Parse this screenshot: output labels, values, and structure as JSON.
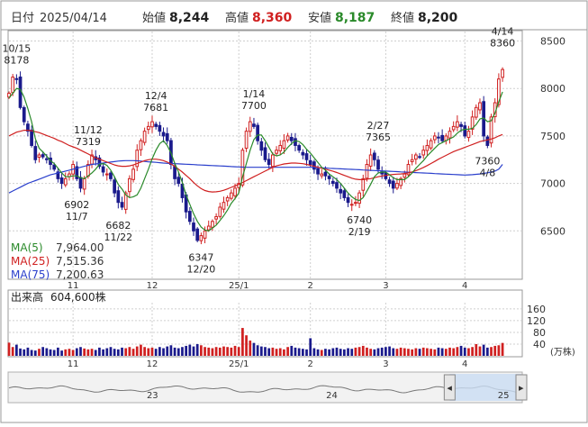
{
  "header": {
    "date_label": "日付",
    "date": "2025/04/14",
    "open_label": "始値",
    "open": "8,244",
    "high_label": "高値",
    "high": "8,360",
    "low_label": "安値",
    "low": "8,187",
    "close_label": "終値",
    "close": "8,200"
  },
  "colors": {
    "up": "#d02020",
    "down": "#1a1a8c",
    "ma5": "#2a8a2a",
    "ma25": "#d02020",
    "ma75": "#2a3fcc",
    "grid": "#cfcfcf",
    "high_value": "#d02020",
    "low_value": "#2a8a2a"
  },
  "legend": [
    {
      "label": "MA(5)",
      "value": "7,964.00",
      "color": "#2a8a2a"
    },
    {
      "label": "MA(25)",
      "value": "7,515.36",
      "color": "#d02020"
    },
    {
      "label": "MA(75)",
      "value": "7,200.63",
      "color": "#2a3fcc"
    }
  ],
  "volume_panel": {
    "label": "出来高",
    "value": "604,600株",
    "unit": "(万株)"
  },
  "chart_data": {
    "type": "candlestick",
    "ylim": [
      6000,
      8600
    ],
    "y_ticks": [
      6500,
      7000,
      7500,
      8000,
      8500
    ],
    "x_range": [
      0,
      136
    ],
    "x_ticks": [
      {
        "label": "11",
        "index": 17
      },
      {
        "label": "12",
        "index": 38
      },
      {
        "label": "25/1",
        "index": 61
      },
      {
        "label": "2",
        "index": 80
      },
      {
        "label": "3",
        "index": 100
      },
      {
        "label": "4",
        "index": 121
      }
    ],
    "annotations": [
      {
        "date": "10/15",
        "value": "8178",
        "index": 2,
        "price": 8178,
        "pos": "above"
      },
      {
        "date": "11/12",
        "value": "7319",
        "index": 21,
        "price": 7319,
        "pos": "above"
      },
      {
        "date": "11/7",
        "value": "6902",
        "index": 18,
        "price": 6902,
        "pos": "below"
      },
      {
        "date": "12/4",
        "value": "7681",
        "index": 39,
        "price": 7681,
        "pos": "above"
      },
      {
        "date": "11/22",
        "value": "6682",
        "index": 29,
        "price": 6682,
        "pos": "below"
      },
      {
        "date": "12/20",
        "value": "6347",
        "index": 51,
        "price": 6347,
        "pos": "below"
      },
      {
        "date": "1/14",
        "value": "7700",
        "index": 65,
        "price": 7700,
        "pos": "above"
      },
      {
        "date": "2/19",
        "value": "6740",
        "index": 93,
        "price": 6740,
        "pos": "below"
      },
      {
        "date": "2/27",
        "value": "7365",
        "index": 98,
        "price": 7365,
        "pos": "above"
      },
      {
        "date": "4/8",
        "value": "7360",
        "index": 127,
        "price": 7360,
        "pos": "below"
      },
      {
        "date": "4/14",
        "value": "8360",
        "index": 131,
        "price": 8360,
        "pos": "above"
      }
    ],
    "close": [
      7950,
      8120,
      8100,
      7800,
      7650,
      7550,
      7400,
      7250,
      7300,
      7280,
      7250,
      7200,
      7150,
      7050,
      7000,
      7050,
      7100,
      7200,
      7050,
      6950,
      7050,
      7200,
      7300,
      7250,
      7180,
      7120,
      7100,
      7050,
      6900,
      6800,
      6750,
      6900,
      7050,
      7150,
      7350,
      7450,
      7550,
      7600,
      7650,
      7600,
      7550,
      7500,
      7450,
      7200,
      7050,
      7000,
      6850,
      6700,
      6600,
      6500,
      6400,
      6450,
      6500,
      6550,
      6600,
      6650,
      6750,
      6800,
      6850,
      6900,
      6950,
      7000,
      7350,
      7550,
      7650,
      7600,
      7450,
      7350,
      7250,
      7200,
      7300,
      7350,
      7400,
      7450,
      7500,
      7450,
      7400,
      7350,
      7300,
      7250,
      7200,
      7150,
      7100,
      7100,
      7080,
      7050,
      7000,
      6950,
      6900,
      6850,
      6800,
      6780,
      6800,
      6900,
      7050,
      7200,
      7300,
      7250,
      7150,
      7100,
      7050,
      7000,
      6950,
      7000,
      7050,
      7100,
      7200,
      7250,
      7300,
      7280,
      7350,
      7400,
      7450,
      7500,
      7480,
      7450,
      7500,
      7550,
      7600,
      7650,
      7600,
      7500,
      7550,
      7700,
      7800,
      7850,
      7500,
      7400,
      7700,
      7850,
      8100,
      8200
    ],
    "ma5": [
      7900,
      7950,
      8000,
      7990,
      7910,
      7790,
      7650,
      7470,
      7370,
      7330,
      7290,
      7240,
      7210,
      7160,
      7110,
      7070,
      7070,
      7080,
      7080,
      7060,
      7050,
      7080,
      7110,
      7150,
      7200,
      7210,
      7190,
      7140,
      7070,
      6990,
      6940,
      6880,
      6850,
      6860,
      6880,
      6950,
      7050,
      7150,
      7260,
      7350,
      7420,
      7450,
      7400,
      7320,
      7210,
      7120,
      7010,
      6880,
      6780,
      6680,
      6600,
      6540,
      6510,
      6500,
      6530,
      6560,
      6610,
      6660,
      6720,
      6790,
      6840,
      6900,
      7070,
      7210,
      7350,
      7460,
      7510,
      7510,
      7450,
      7380,
      7310,
      7290,
      7300,
      7330,
      7380,
      7420,
      7450,
      7440,
      7410,
      7360,
      7320,
      7270,
      7220,
      7170,
      7140,
      7100,
      7070,
      7040,
      7000,
      6950,
      6900,
      6860,
      6830,
      6820,
      6850,
      6920,
      6990,
      7070,
      7110,
      7120,
      7120,
      7090,
      7060,
      7040,
      7040,
      7040,
      7070,
      7110,
      7160,
      7200,
      7240,
      7290,
      7330,
      7370,
      7410,
      7430,
      7450,
      7470,
      7490,
      7530,
      7560,
      7570,
      7570,
      7580,
      7620,
      7680,
      7690,
      7650,
      7660,
      7740,
      7860,
      7964
    ],
    "ma25": [
      7500,
      7520,
      7540,
      7550,
      7560,
      7560,
      7555,
      7545,
      7535,
      7520,
      7505,
      7490,
      7475,
      7455,
      7440,
      7420,
      7400,
      7385,
      7370,
      7350,
      7330,
      7310,
      7290,
      7270,
      7255,
      7240,
      7225,
      7210,
      7195,
      7185,
      7180,
      7180,
      7185,
      7195,
      7210,
      7225,
      7240,
      7250,
      7255,
      7255,
      7250,
      7240,
      7225,
      7205,
      7180,
      7150,
      7120,
      7085,
      7050,
      7010,
      6975,
      6945,
      6925,
      6915,
      6910,
      6912,
      6918,
      6928,
      6942,
      6958,
      6975,
      6990,
      7010,
      7030,
      7050,
      7070,
      7090,
      7110,
      7130,
      7150,
      7170,
      7185,
      7195,
      7205,
      7210,
      7215,
      7215,
      7212,
      7208,
      7200,
      7190,
      7180,
      7170,
      7160,
      7150,
      7140,
      7128,
      7115,
      7100,
      7085,
      7070,
      7055,
      7045,
      7040,
      7040,
      7045,
      7050,
      7060,
      7070,
      7078,
      7085,
      7090,
      7095,
      7098,
      7100,
      7105,
      7112,
      7122,
      7135,
      7150,
      7168,
      7188,
      7210,
      7232,
      7255,
      7275,
      7295,
      7315,
      7335,
      7350,
      7365,
      7380,
      7395,
      7410,
      7425,
      7440,
      7450,
      7458,
      7468,
      7480,
      7500,
      7515.36
    ],
    "ma75": [
      6900,
      6920,
      6940,
      6960,
      6980,
      7000,
      7015,
      7030,
      7045,
      7060,
      7075,
      7090,
      7100,
      7110,
      7120,
      7130,
      7140,
      7150,
      7160,
      7170,
      7180,
      7190,
      7200,
      7205,
      7210,
      7215,
      7220,
      7225,
      7230,
      7235,
      7238,
      7240,
      7240,
      7240,
      7238,
      7235,
      7232,
      7228,
      7225,
      7222,
      7218,
      7215,
      7212,
      7210,
      7208,
      7206,
      7204,
      7202,
      7200,
      7198,
      7196,
      7194,
      7192,
      7190,
      7188,
      7186,
      7184,
      7182,
      7180,
      7178,
      7176,
      7174,
      7172,
      7170,
      7170,
      7170,
      7170,
      7170,
      7170,
      7170,
      7170,
      7170,
      7170,
      7170,
      7170,
      7170,
      7170,
      7170,
      7170,
      7170,
      7170,
      7168,
      7166,
      7164,
      7162,
      7160,
      7158,
      7156,
      7154,
      7152,
      7150,
      7148,
      7146,
      7144,
      7142,
      7140,
      7138,
      7136,
      7134,
      7132,
      7130,
      7128,
      7126,
      7124,
      7122,
      7120,
      7118,
      7116,
      7114,
      7112,
      7110,
      7108,
      7106,
      7104,
      7102,
      7100,
      7098,
      7096,
      7094,
      7092,
      7090,
      7088,
      7090,
      7092,
      7096,
      7100,
      7106,
      7112,
      7120,
      7130,
      7150,
      7200.63
    ],
    "volume": [
      45,
      30,
      38,
      25,
      22,
      28,
      20,
      18,
      24,
      30,
      26,
      22,
      20,
      28,
      18,
      22,
      24,
      20,
      26,
      30,
      25,
      22,
      24,
      20,
      28,
      22,
      26,
      30,
      24,
      22,
      28,
      26,
      30,
      24,
      32,
      38,
      30,
      26,
      28,
      24,
      30,
      26,
      32,
      36,
      28,
      26,
      30,
      34,
      38,
      32,
      40,
      36,
      30,
      28,
      26,
      30,
      28,
      32,
      30,
      28,
      34,
      30,
      95,
      70,
      52,
      44,
      36,
      32,
      30,
      26,
      28,
      24,
      26,
      22,
      30,
      34,
      28,
      26,
      24,
      22,
      60,
      26,
      22,
      20,
      24,
      22,
      26,
      28,
      24,
      22,
      26,
      24,
      28,
      30,
      34,
      28,
      24,
      22,
      26,
      28,
      30,
      32,
      26,
      24,
      28,
      26,
      24,
      22,
      26,
      24,
      28,
      26,
      24,
      22,
      28,
      26,
      24,
      28,
      26,
      30,
      34,
      28,
      26,
      30,
      40,
      32,
      38,
      28,
      30,
      34,
      36,
      44
    ],
    "volume_ticks": [
      40,
      80,
      120,
      160
    ],
    "volume_ylim": [
      0,
      175
    ]
  },
  "navigator": {
    "year_labels": [
      {
        "label": "23",
        "pos": 0.28
      },
      {
        "label": "24",
        "pos": 0.63
      },
      {
        "label": "25",
        "pos": 0.965
      }
    ],
    "window_start": 0.86,
    "window_end": 1.0
  }
}
